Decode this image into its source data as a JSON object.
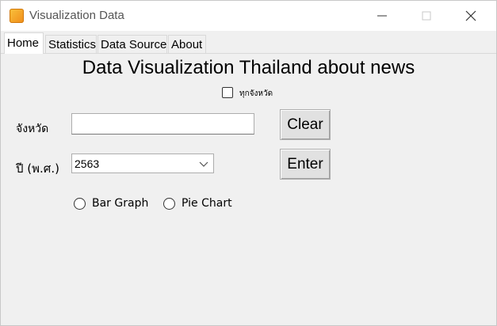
{
  "window": {
    "title": "Visualization Data",
    "controls": {
      "minimize": "minimize",
      "maximize": "maximize",
      "close": "close"
    }
  },
  "tabs": [
    {
      "label": "Home",
      "active": true
    },
    {
      "label": "Statistics",
      "active": false
    },
    {
      "label": "Data Source",
      "active": false
    },
    {
      "label": "About",
      "active": false
    }
  ],
  "main": {
    "heading": "Data Visualization Thailand about news",
    "all_provinces_label": "ทุกจังหวัด",
    "all_provinces_checked": false,
    "province_label": "จังหวัด",
    "province_value": "",
    "year_label": "ปี (พ.ศ.)",
    "year_selected": "2563",
    "clear_button": "Clear",
    "enter_button": "Enter",
    "chart_options": [
      {
        "label": "Bar Graph",
        "selected": false
      },
      {
        "label": "Pie Chart",
        "selected": false
      }
    ]
  },
  "icons": {
    "app": "app-icon",
    "minimize": "minimize-icon",
    "maximize": "maximize-icon",
    "close": "close-icon",
    "dropdown": "chevron-down-icon"
  }
}
